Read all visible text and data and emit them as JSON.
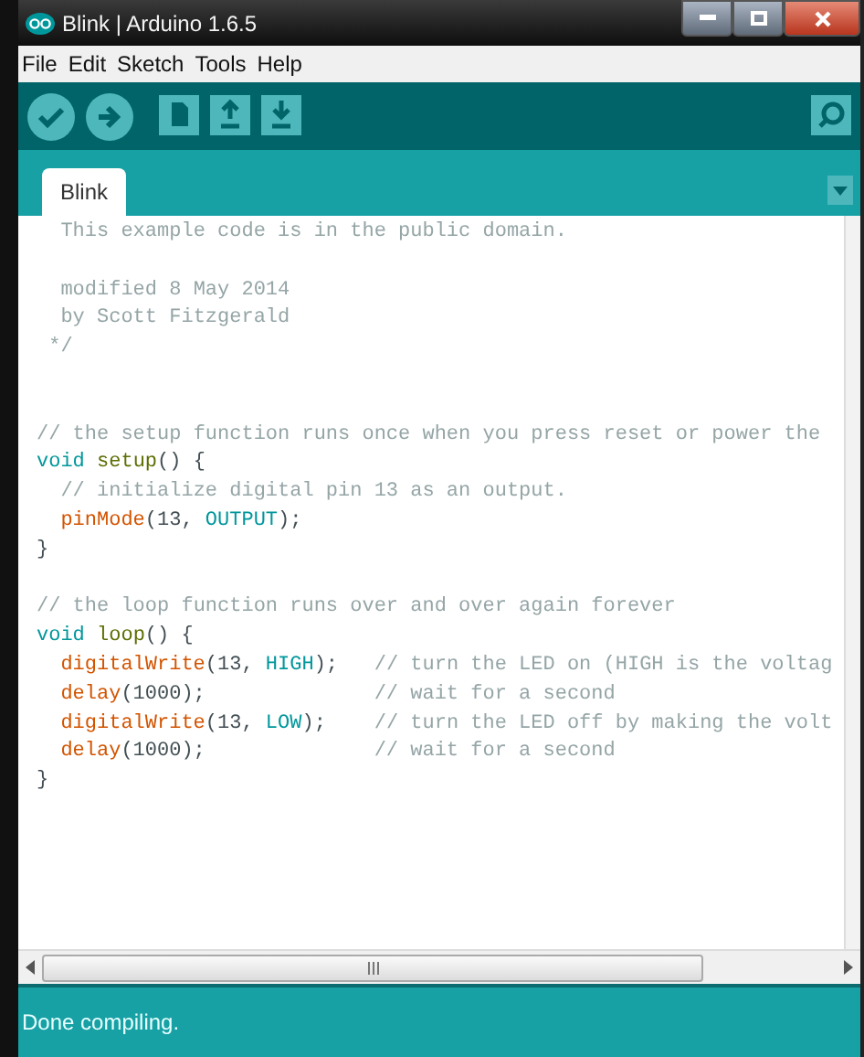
{
  "window": {
    "title": "Blink | Arduino 1.6.5"
  },
  "menu": [
    "File",
    "Edit",
    "Sketch",
    "Tools",
    "Help"
  ],
  "toolbar": [
    {
      "kind": "verify"
    },
    {
      "kind": "upload"
    },
    {
      "kind": "new"
    },
    {
      "kind": "open"
    },
    {
      "kind": "save"
    },
    {
      "kind": "monitor"
    }
  ],
  "tabs": [
    {
      "label": "Blink",
      "selected": true
    }
  ],
  "code_lines": [
    {
      "kind": "code",
      "tokens": [
        {
          "kind": "comment",
          "text": "  This example code is in the public domain."
        }
      ]
    },
    {
      "kind": "blank"
    },
    {
      "kind": "code",
      "tokens": [
        {
          "kind": "comment",
          "text": "  modified 8 May 2014"
        }
      ]
    },
    {
      "kind": "code",
      "tokens": [
        {
          "kind": "comment",
          "text": "  by Scott Fitzgerald"
        }
      ]
    },
    {
      "kind": "code",
      "tokens": [
        {
          "kind": "comment",
          "text": " */"
        }
      ]
    },
    {
      "kind": "blank"
    },
    {
      "kind": "blank"
    },
    {
      "kind": "code",
      "tokens": [
        {
          "kind": "comment",
          "text": "// the setup function runs once when you press reset or power the"
        }
      ]
    },
    {
      "kind": "code",
      "tokens": [
        {
          "kind": "keyword",
          "text": "void "
        },
        {
          "kind": "name",
          "text": "setup"
        },
        {
          "kind": "plain",
          "text": "() {"
        }
      ]
    },
    {
      "kind": "code",
      "tokens": [
        {
          "kind": "comment",
          "text": "  // initialize digital pin 13 as an output."
        }
      ]
    },
    {
      "kind": "code",
      "indented": true,
      "tokens": [
        {
          "kind": "function",
          "text": "pinMode"
        },
        {
          "kind": "plain",
          "text": "(13, "
        },
        {
          "kind": "constant",
          "text": "OUTPUT"
        },
        {
          "kind": "plain",
          "text": ");"
        }
      ]
    },
    {
      "kind": "code",
      "tokens": [
        {
          "kind": "plain",
          "text": "}"
        }
      ]
    },
    {
      "kind": "blank"
    },
    {
      "kind": "code",
      "tokens": [
        {
          "kind": "comment",
          "text": "// the loop function runs over and over again forever"
        }
      ]
    },
    {
      "kind": "code",
      "tokens": [
        {
          "kind": "keyword",
          "text": "void "
        },
        {
          "kind": "name",
          "text": "loop"
        },
        {
          "kind": "plain",
          "text": "() {"
        }
      ]
    },
    {
      "kind": "code",
      "indented": true,
      "tokens": [
        {
          "kind": "function",
          "text": "digitalWrite"
        },
        {
          "kind": "plain",
          "text": "(13, "
        },
        {
          "kind": "constant",
          "text": "HIGH"
        },
        {
          "kind": "plain",
          "text": ");   "
        },
        {
          "kind": "comment",
          "text": "// turn the LED on (HIGH is the voltag"
        }
      ]
    },
    {
      "kind": "code",
      "indented": true,
      "tokens": [
        {
          "kind": "function",
          "text": "delay"
        },
        {
          "kind": "plain",
          "text": "(1000);              "
        },
        {
          "kind": "comment",
          "text": "// wait for a second"
        }
      ]
    },
    {
      "kind": "code",
      "indented": true,
      "tokens": [
        {
          "kind": "function",
          "text": "digitalWrite"
        },
        {
          "kind": "plain",
          "text": "(13, "
        },
        {
          "kind": "constant",
          "text": "LOW"
        },
        {
          "kind": "plain",
          "text": ");    "
        },
        {
          "kind": "comment",
          "text": "// turn the LED off by making the volt"
        }
      ]
    },
    {
      "kind": "code",
      "indented": true,
      "tokens": [
        {
          "kind": "function",
          "text": "delay"
        },
        {
          "kind": "plain",
          "text": "(1000);              "
        },
        {
          "kind": "comment",
          "text": "// wait for a second"
        }
      ]
    },
    {
      "kind": "code",
      "tokens": [
        {
          "kind": "plain",
          "text": "}"
        }
      ]
    }
  ],
  "status_bar": {
    "text": "Done compiling."
  }
}
